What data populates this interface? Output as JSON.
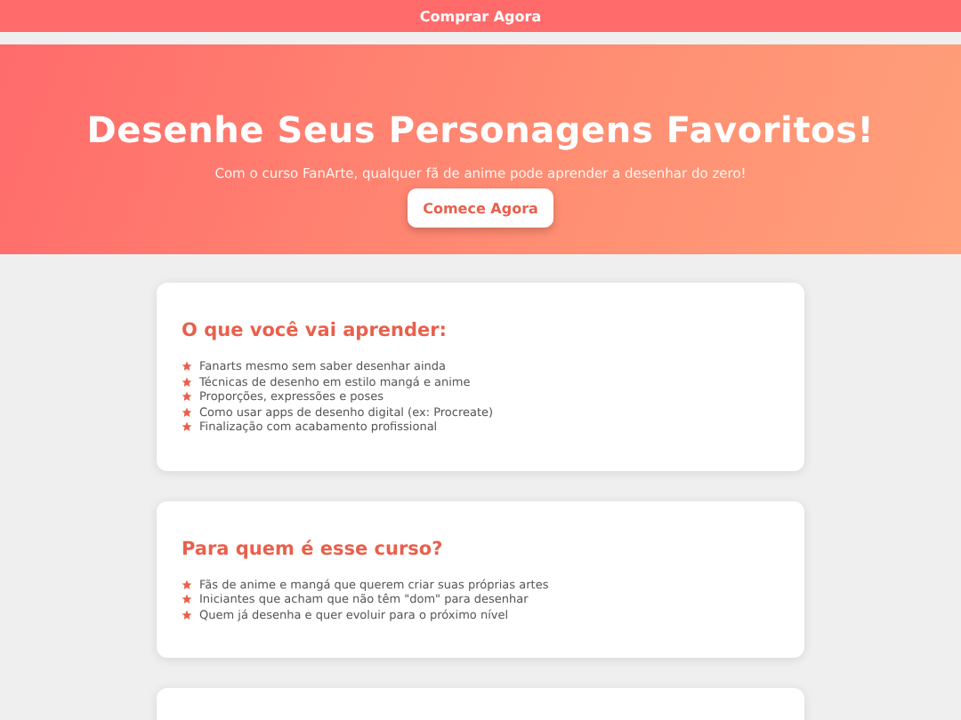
{
  "top_bar": {
    "link": "Comprar Agora"
  },
  "hero": {
    "title": "Desenhe Seus Personagens Favoritos!",
    "subtitle": "Com o curso FanArte, qualquer fã de anime pode aprender a desenhar do zero!",
    "button": "Comece Agora"
  },
  "sections": [
    {
      "heading": "O que você vai aprender:",
      "items": [
        "Fanarts mesmo sem saber desenhar ainda",
        "Técnicas de desenho em estilo mangá e anime",
        "Proporções, expressões e poses",
        "Como usar apps de desenho digital (ex: Procreate)",
        "Finalização com acabamento profissional"
      ]
    },
    {
      "heading": "Para quem é esse curso?",
      "items": [
        "Fãs de anime e mangá que querem criar suas próprias artes",
        "Iniciantes que acham que não têm \"dom\" para desenhar",
        "Quem já desenha e quer evoluir para o próximo nível"
      ]
    }
  ]
}
